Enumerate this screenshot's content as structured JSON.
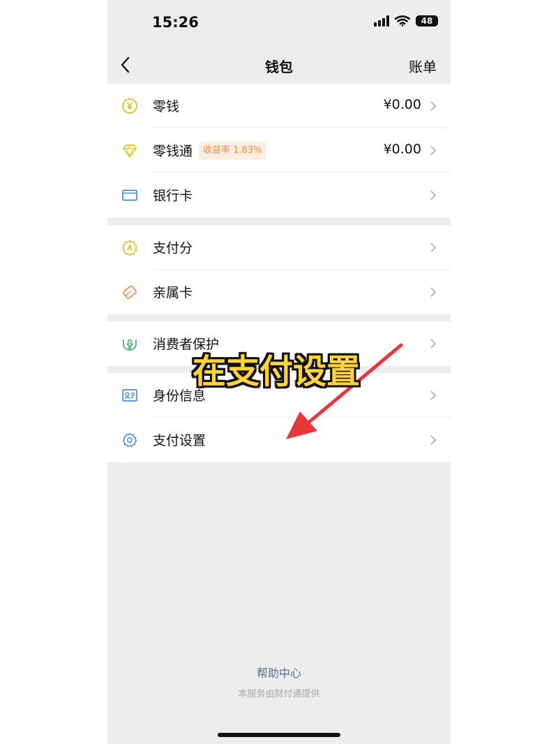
{
  "status_bar": {
    "time": "15:26",
    "battery": "48",
    "icons": [
      "signal-icon",
      "wifi-icon",
      "battery-icon"
    ]
  },
  "nav": {
    "back_icon": "chevron-left-icon",
    "title": "钱包",
    "right_action": "账单"
  },
  "sections": [
    {
      "items": [
        {
          "icon": "yuan-coin-icon",
          "label": "零钱",
          "value": "¥0.00"
        },
        {
          "icon": "diamond-icon",
          "label": "零钱通",
          "badge": "收益率 1.83%",
          "value": "¥0.00"
        },
        {
          "icon": "bank-card-icon",
          "label": "银行卡"
        }
      ]
    },
    {
      "items": [
        {
          "icon": "payment-score-icon",
          "label": "支付分"
        },
        {
          "icon": "family-card-icon",
          "label": "亲属卡"
        }
      ]
    },
    {
      "items": [
        {
          "icon": "consumer-protection-icon",
          "label": "消费者保护"
        }
      ]
    },
    {
      "items": [
        {
          "icon": "id-card-icon",
          "label": "身份信息"
        },
        {
          "icon": "gear-icon",
          "label": "支付设置"
        }
      ]
    }
  ],
  "footer": {
    "help_center": "帮助中心",
    "provider": "本服务由财付通提供"
  },
  "overlay": {
    "caption": "在支付设置",
    "caption_color": "#ffd43b",
    "arrow_color": "#e8363a"
  },
  "colors": {
    "background": "#ededed",
    "card": "#ffffff",
    "link": "#576b95",
    "badge_bg": "#fdeee1",
    "badge_text": "#f08a3c"
  }
}
